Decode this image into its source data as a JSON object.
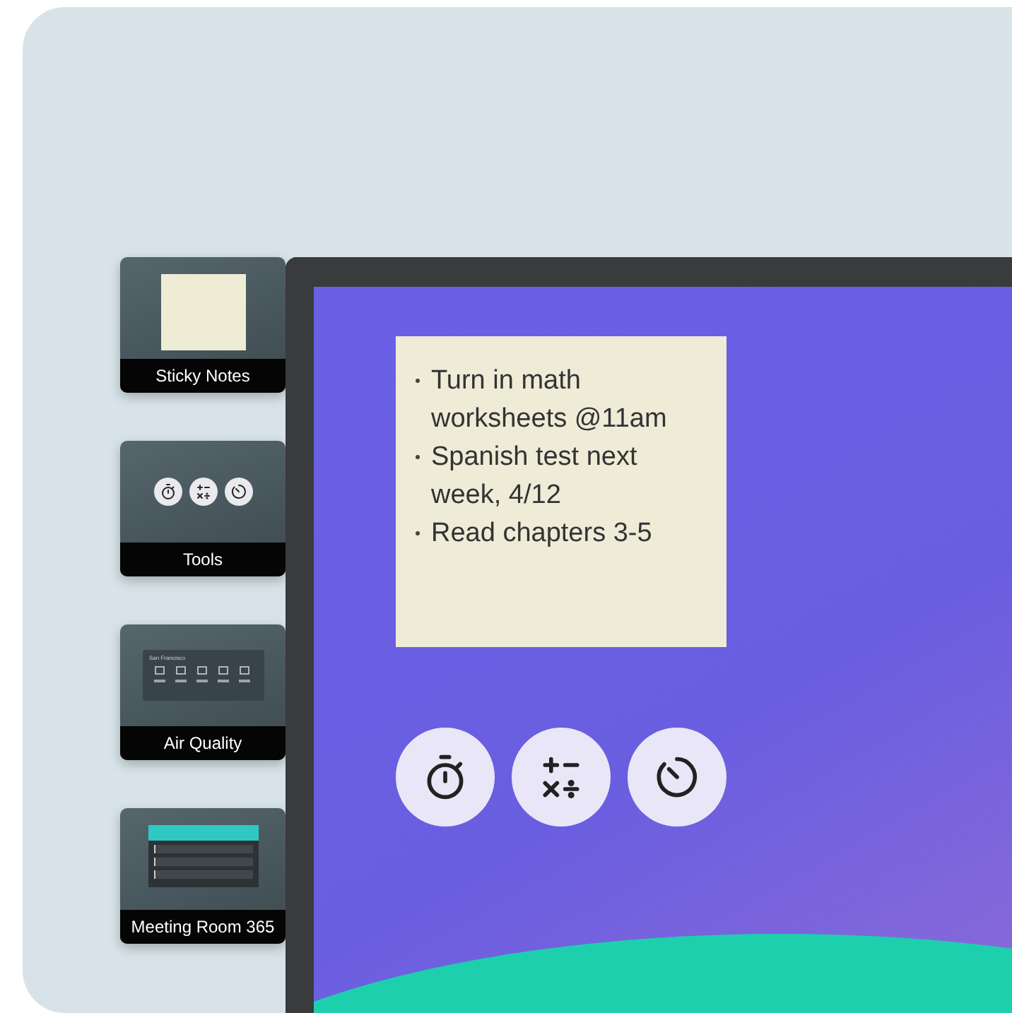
{
  "widgets": [
    {
      "kind": "sticky",
      "label": "Sticky Notes"
    },
    {
      "kind": "tools",
      "label": "Tools"
    },
    {
      "kind": "air",
      "label": "Air Quality",
      "city": "San Francisco"
    },
    {
      "kind": "meeting",
      "label": "Meeting Room 365"
    }
  ],
  "note": {
    "items": [
      "Turn in math worksheets @11am",
      "Spanish test next week, 4/12",
      "Read chapters 3-5"
    ]
  },
  "tools": [
    {
      "kind": "stopwatch"
    },
    {
      "kind": "calculator"
    },
    {
      "kind": "timer"
    }
  ]
}
